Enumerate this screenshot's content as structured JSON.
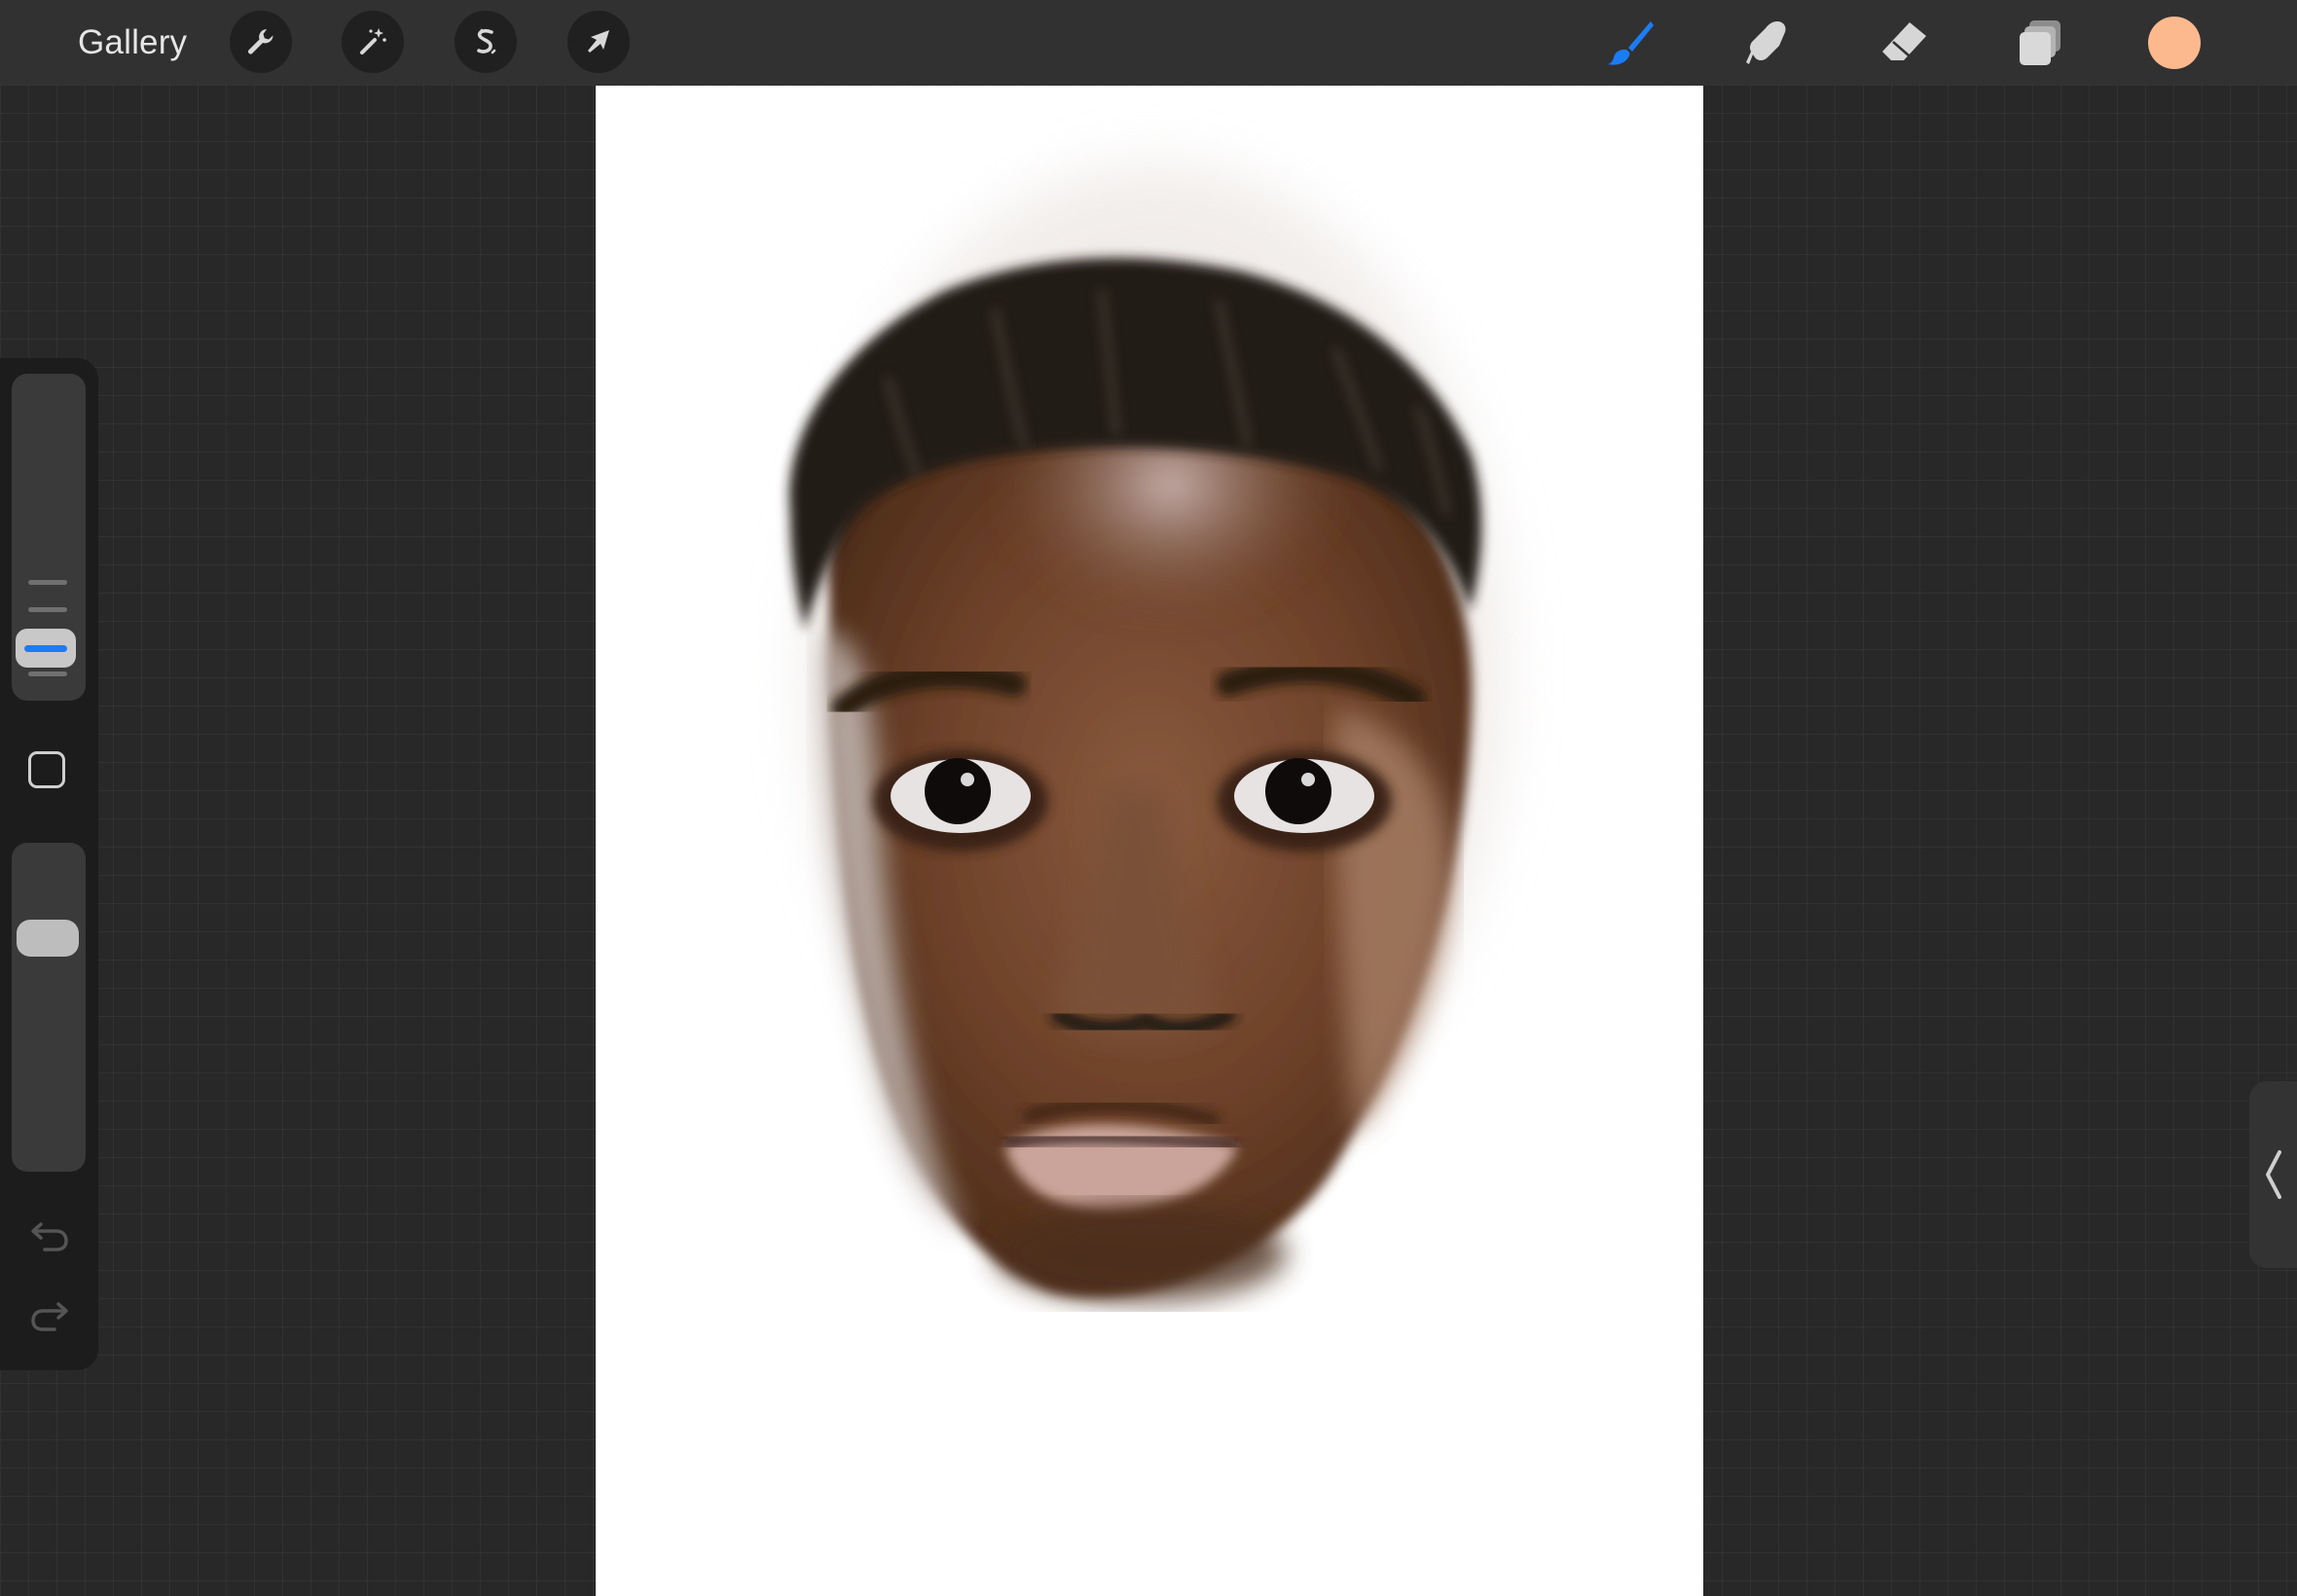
{
  "topbar": {
    "gallery_label": "Gallery",
    "left_tools": [
      {
        "name": "actions",
        "icon": "wrench-icon"
      },
      {
        "name": "adjustments",
        "icon": "magic-wand-icon"
      },
      {
        "name": "selection",
        "icon": "selection-s-icon"
      },
      {
        "name": "transform",
        "icon": "arrow-cursor-icon"
      }
    ],
    "right_tools": [
      {
        "name": "brush",
        "icon": "brush-icon",
        "active": true
      },
      {
        "name": "smudge",
        "icon": "smudge-finger-icon",
        "active": false
      },
      {
        "name": "eraser",
        "icon": "eraser-icon",
        "active": false
      },
      {
        "name": "layers",
        "icon": "layers-icon",
        "active": false
      }
    ],
    "current_color": "#fdb98e"
  },
  "canvas": {
    "content": "portrait-painting",
    "background": "#ffffff"
  },
  "sidebar": {
    "brush_size_icon": "slider-thumb",
    "modify_button_icon": "square-outline-icon",
    "undo_icon": "undo-icon",
    "redo_icon": "redo-icon"
  },
  "right_panel_tab": {
    "icon": "chevron-left-icon"
  },
  "colors": {
    "accent": "#1c7cf4",
    "topbar": "#313131",
    "workspace": "#282828",
    "sidebar": "#1c1c1c"
  }
}
